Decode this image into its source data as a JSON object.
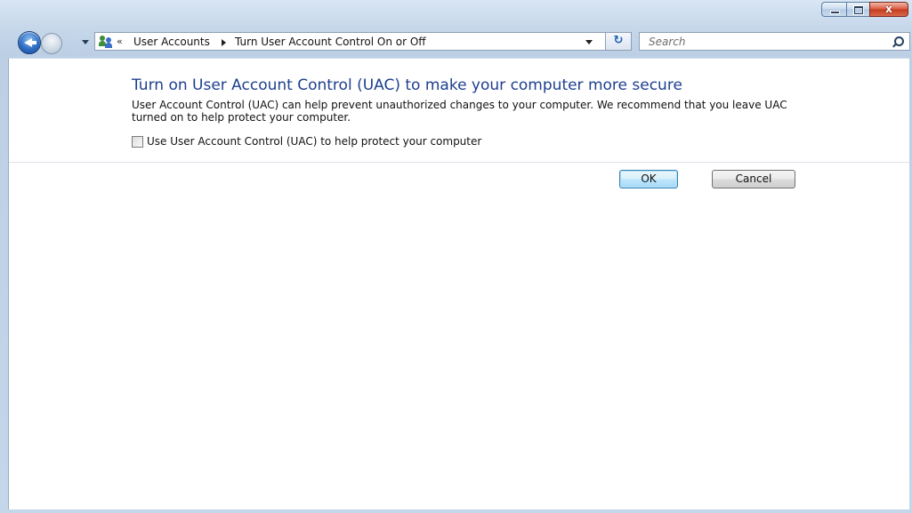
{
  "window": {
    "close_glyph": "x"
  },
  "nav": {
    "breadcrumb_root_glyph": "«",
    "breadcrumbs": [
      "User Accounts",
      "Turn User Account Control On or Off"
    ],
    "refresh_glyph": "↻",
    "search_placeholder": "Search"
  },
  "main": {
    "heading": "Turn on User Account Control (UAC) to make your computer more secure",
    "description": "User Account Control (UAC) can help prevent unauthorized changes to your computer.  We recommend that you leave UAC turned on to help protect your computer.",
    "checkbox_label": "Use User Account Control (UAC) to help protect your computer",
    "checkbox_checked": false,
    "ok_label": "OK",
    "cancel_label": "Cancel"
  },
  "colors": {
    "heading": "#1e3f8f",
    "frame": "#c4d6ea",
    "close_button": "#c43b1e"
  }
}
